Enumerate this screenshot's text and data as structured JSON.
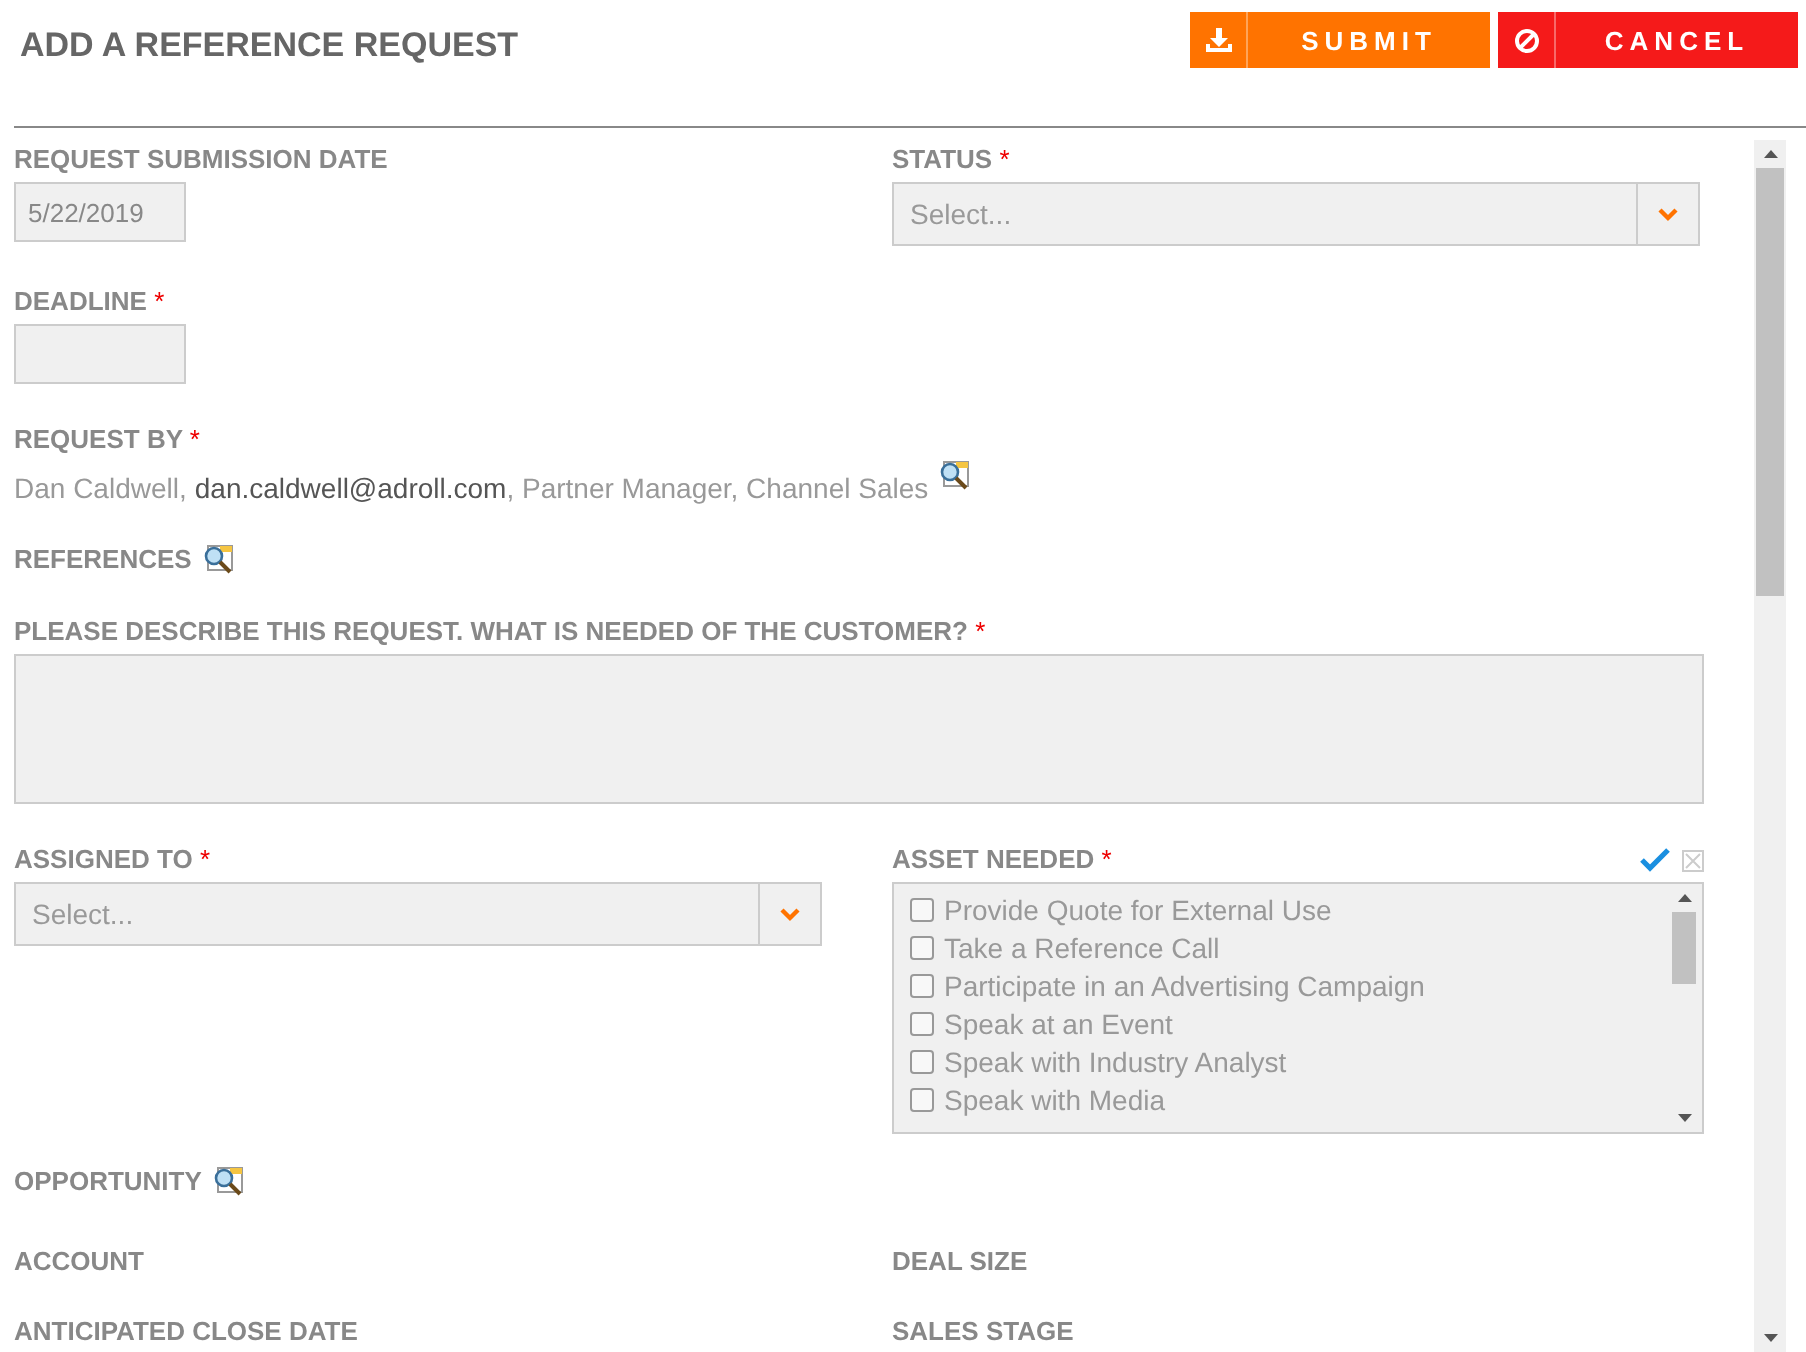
{
  "title": "ADD A REFERENCE REQUEST",
  "buttons": [
    {
      "kind": "submit",
      "label": "SUBMIT"
    },
    {
      "kind": "cancel",
      "label": "CANCEL"
    }
  ],
  "submission_date": {
    "label": "REQUEST SUBMISSION DATE",
    "value": "5/22/2019"
  },
  "status": {
    "label": "STATUS",
    "mark": "*",
    "placeholder": "Select..."
  },
  "deadline": {
    "label": "DEADLINE",
    "mark": "*"
  },
  "request_by": {
    "label": "REQUEST BY",
    "mark": "*",
    "name": "Dan Caldwell,",
    "email": "dan.caldwell@adroll.com",
    "role": ", Partner Manager, Channel Sales"
  },
  "references": {
    "label": "REFERENCES"
  },
  "description": {
    "label": "PLEASE DESCRIBE THIS REQUEST. WHAT IS NEEDED OF THE CUSTOMER?",
    "mark": "*"
  },
  "assigned_to": {
    "label": "ASSIGNED TO",
    "mark": "*",
    "placeholder": "Select..."
  },
  "asset_needed": {
    "label": "ASSET NEEDED",
    "mark": "*",
    "options": [
      {
        "label": "Provide Quote for External Use",
        "checked": false
      },
      {
        "label": "Take a Reference Call",
        "checked": false
      },
      {
        "label": "Participate in an Advertising Campaign",
        "checked": false
      },
      {
        "label": "Speak at an Event",
        "checked": false
      },
      {
        "label": "Speak with Industry Analyst",
        "checked": false
      },
      {
        "label": "Speak with Media",
        "checked": false
      }
    ]
  },
  "opportunity": {
    "label": "OPPORTUNITY"
  },
  "account": {
    "label": "ACCOUNT"
  },
  "deal_size": {
    "label": "DEAL SIZE"
  },
  "close_date": {
    "label": "ANTICIPATED CLOSE DATE"
  },
  "sales_stage": {
    "label": "SALES STAGE"
  }
}
